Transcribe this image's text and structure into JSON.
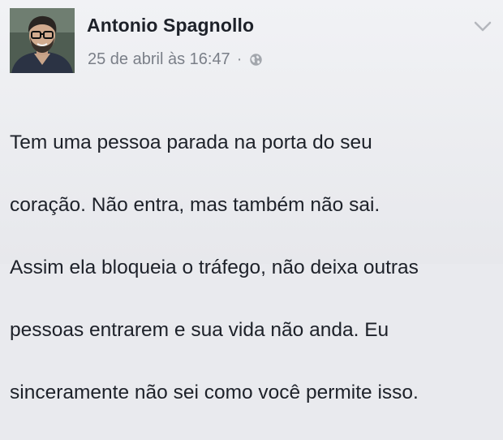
{
  "post": {
    "author": {
      "name": "Antonio Spagnollo",
      "avatar": "author-avatar-photo"
    },
    "timestamp": "25 de abril às 16:47",
    "separator": "·",
    "privacy_icon": "globe-icon",
    "menu_icon": "chevron-down-icon",
    "text_lines": [
      "Tem uma pessoa parada na porta do seu",
      "coração. Não entra, mas também não sai.",
      "Assim ela bloqueia o tráfego, não deixa outras",
      "pessoas entrarem e sua vida não anda. Eu",
      "sinceramente não sei como você permite isso."
    ]
  },
  "colors": {
    "background": "#eeeff2",
    "author_name": "#1d2129",
    "meta_text": "#7a7f88",
    "body_text": "#1d2129"
  }
}
